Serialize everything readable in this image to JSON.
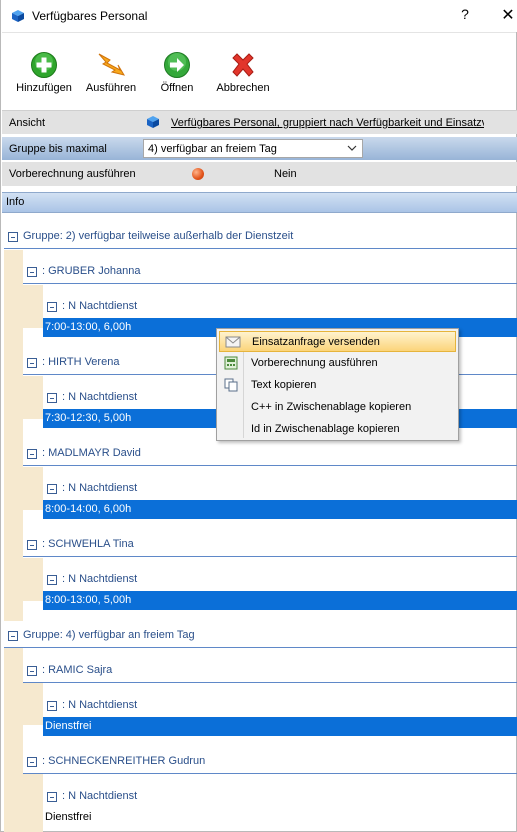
{
  "window": {
    "title": "Verfügbares Personal",
    "help": "?",
    "close": "✕"
  },
  "toolbar": {
    "add_label": "Hinzufügen",
    "run_label": "Ausführen",
    "open_label": "Öffnen",
    "cancel_label": "Abbrechen"
  },
  "props": {
    "ansicht_label": "Ansicht",
    "ansicht_value": "Verfügbares Personal, gruppiert nach Verfügbarkeit und Einsatzvar",
    "gruppe_label": "Gruppe bis maximal",
    "gruppe_value": "4) verfügbar an freiem Tag",
    "vorb_label": "Vorberechnung ausführen",
    "vorb_value": "Nein"
  },
  "info_header": "Info",
  "tree": {
    "group1": "Gruppe: 2) verfügbar teilweise außerhalb der Dienstzeit",
    "group2": "Gruppe: 4) verfügbar an freiem Tag",
    "persons": [
      {
        "name": ": GRUBER Johanna",
        "shift": ": N Nachtdienst",
        "detail": "7:00-13:00, 6,00h"
      },
      {
        "name": ": HIRTH Verena",
        "shift": ": N Nachtdienst",
        "detail": "7:30-12:30, 5,00h"
      },
      {
        "name": ": MADLMAYR David",
        "shift": ": N Nachtdienst",
        "detail": "8:00-14:00, 6,00h"
      },
      {
        "name": ": SCHWEHLA Tina",
        "shift": ": N Nachtdienst",
        "detail": "8:00-13:00, 5,00h"
      },
      {
        "name": ": RAMIC Sajra",
        "shift": ": N Nachtdienst",
        "detail": "Dienstfrei"
      },
      {
        "name": ": SCHNECKENREITHER Gudrun",
        "shift": ": N Nachtdienst",
        "detail": "Dienstfrei"
      }
    ]
  },
  "context_menu": {
    "items": [
      "Einsatzanfrage versenden",
      "Vorberechnung ausführen",
      "Text kopieren",
      "C++ in Zwischenablage kopieren",
      "Id in Zwischenablage kopieren"
    ]
  },
  "colors": {
    "selection": "#0b6fd8",
    "tree_text": "#2a4f8a",
    "indent_band": "#f6e9cf",
    "menu_highlight": "#fbd47a"
  }
}
